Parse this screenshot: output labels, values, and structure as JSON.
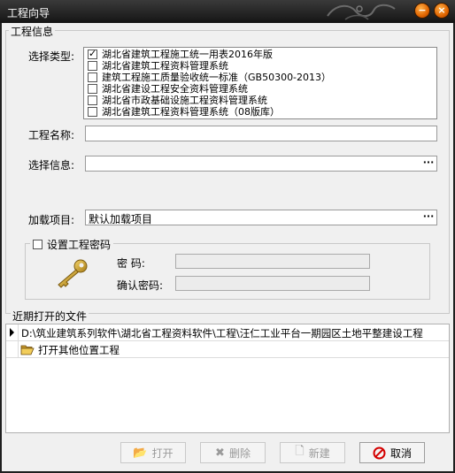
{
  "window": {
    "title": "工程向导",
    "minimize_glyph": "−",
    "close_glyph": "×"
  },
  "project_info": {
    "group_title": "工程信息",
    "type_label": "选择类型:",
    "types": [
      {
        "label": "湖北省建筑工程施工统一用表2016年版",
        "checked": true
      },
      {
        "label": "湖北省建筑工程资料管理系统",
        "checked": false
      },
      {
        "label": "建筑工程施工质量验收统一标准（GB50300-2013）",
        "checked": false
      },
      {
        "label": "湖北省建设工程安全资料管理系统",
        "checked": false
      },
      {
        "label": "湖北省市政基础设施工程资料管理系统",
        "checked": false
      },
      {
        "label": "湖北省建筑工程资料管理系统（08版库）",
        "checked": false
      }
    ],
    "name_label": "工程名称:",
    "name_value": "",
    "info_label": "选择信息:",
    "info_value": "",
    "load_label": "加载项目:",
    "load_value": "默认加载项目",
    "browse_glyph": "···"
  },
  "password": {
    "checkbox_label": "设置工程密码",
    "checked": false,
    "password_label": "密    码:",
    "confirm_label": "确认密码:",
    "password_value": "",
    "confirm_value": "",
    "icon": "key-icon"
  },
  "recent": {
    "group_title": "近期打开的文件",
    "rows": [
      {
        "marker": "current",
        "text": "D:\\筑业建筑系列软件\\湖北省工程资料软件\\工程\\汪仁工业平台一期园区土地平整建设工程"
      },
      {
        "marker": "",
        "text": "打开其他位置工程",
        "icon": "open-folder-icon"
      }
    ]
  },
  "buttons": {
    "open": {
      "label": "打开",
      "enabled": false
    },
    "delete": {
      "label": "删除",
      "enabled": false
    },
    "new": {
      "label": "新建",
      "enabled": false
    },
    "cancel": {
      "label": "取消",
      "enabled": true
    }
  },
  "colors": {
    "titlebar": "#1f1f1f",
    "accent_orange": "#e06400",
    "cancel_red": "#d40000"
  }
}
